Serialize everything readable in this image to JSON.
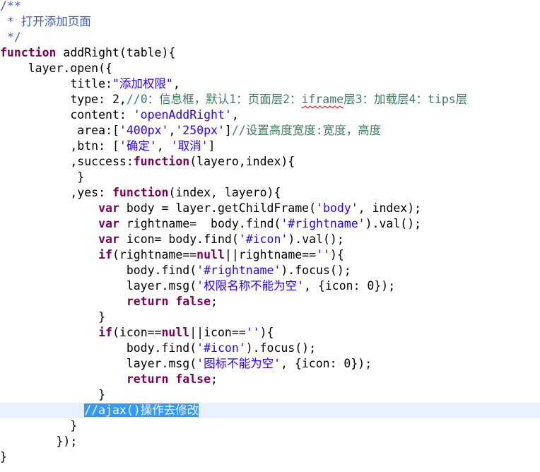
{
  "editor": {
    "colors": {
      "keyword": "#7f0055",
      "string": "#2a00ff",
      "comment": "#3f7f5f",
      "javadoc": "#3f5fbf",
      "plain": "#000000",
      "current_line": "#e8f2fe",
      "selection": "#3399ff"
    },
    "lines": [
      {
        "indent": "",
        "tokens": [
          {
            "t": "/**",
            "k": "javadoc"
          }
        ]
      },
      {
        "indent": " ",
        "tokens": [
          {
            "t": "* 打开添加页面",
            "k": "javadoc"
          }
        ]
      },
      {
        "indent": " ",
        "tokens": [
          {
            "t": "*/",
            "k": "javadoc"
          }
        ]
      },
      {
        "indent": "",
        "tokens": [
          {
            "t": "function",
            "k": "keyword"
          },
          {
            "t": " addRight(table){",
            "k": "plain"
          }
        ]
      },
      {
        "indent": "    ",
        "tokens": [
          {
            "t": "layer.open({",
            "k": "plain"
          }
        ]
      },
      {
        "indent": "          ",
        "tokens": [
          {
            "t": "title:",
            "k": "plain"
          },
          {
            "t": "\"添加权限\"",
            "k": "string"
          },
          {
            "t": ",",
            "k": "plain"
          }
        ]
      },
      {
        "indent": "          ",
        "tokens": [
          {
            "t": "type: 2,",
            "k": "plain"
          },
          {
            "t": "//0：信息框，默认1：页面层2：",
            "k": "comment"
          },
          {
            "t": "iframe",
            "k": "comment",
            "squiggle": true
          },
          {
            "t": "层3：加载层4：tips层",
            "k": "comment"
          }
        ]
      },
      {
        "indent": "          ",
        "tokens": [
          {
            "t": "content: ",
            "k": "plain"
          },
          {
            "t": "'openAddRight'",
            "k": "string"
          },
          {
            "t": ",",
            "k": "plain"
          }
        ]
      },
      {
        "indent": "           ",
        "tokens": [
          {
            "t": "area:[",
            "k": "plain"
          },
          {
            "t": "'400px'",
            "k": "string"
          },
          {
            "t": ",",
            "k": "plain"
          },
          {
            "t": "'250px'",
            "k": "string"
          },
          {
            "t": "]",
            "k": "plain"
          },
          {
            "t": "//设置高度宽度:宽度，高度",
            "k": "comment"
          }
        ]
      },
      {
        "indent": "          ",
        "tokens": [
          {
            "t": ",btn: [",
            "k": "plain"
          },
          {
            "t": "'确定'",
            "k": "string"
          },
          {
            "t": ", ",
            "k": "plain"
          },
          {
            "t": "'取消'",
            "k": "string"
          },
          {
            "t": "]",
            "k": "plain"
          }
        ]
      },
      {
        "indent": "          ",
        "tokens": [
          {
            "t": ",success:",
            "k": "plain"
          },
          {
            "t": "function",
            "k": "keyword"
          },
          {
            "t": "(layero,index){",
            "k": "plain"
          }
        ]
      },
      {
        "indent": "           ",
        "tokens": [
          {
            "t": "}",
            "k": "plain"
          }
        ]
      },
      {
        "indent": "          ",
        "tokens": [
          {
            "t": ",yes: ",
            "k": "plain"
          },
          {
            "t": "function",
            "k": "keyword"
          },
          {
            "t": "(index, layero){",
            "k": "plain"
          }
        ]
      },
      {
        "indent": "              ",
        "tokens": [
          {
            "t": "var",
            "k": "keyword"
          },
          {
            "t": " body = layer.getChildFrame(",
            "k": "plain"
          },
          {
            "t": "'body'",
            "k": "string"
          },
          {
            "t": ", index);",
            "k": "plain"
          }
        ]
      },
      {
        "indent": "              ",
        "tokens": [
          {
            "t": "var",
            "k": "keyword"
          },
          {
            "t": " rightname=  body.find(",
            "k": "plain"
          },
          {
            "t": "'#rightname'",
            "k": "string"
          },
          {
            "t": ").val();",
            "k": "plain"
          }
        ]
      },
      {
        "indent": "              ",
        "tokens": [
          {
            "t": "var",
            "k": "keyword"
          },
          {
            "t": " icon= body.find(",
            "k": "plain"
          },
          {
            "t": "'#icon'",
            "k": "string"
          },
          {
            "t": ").val();",
            "k": "plain"
          }
        ]
      },
      {
        "indent": "              ",
        "tokens": [
          {
            "t": "if",
            "k": "keyword"
          },
          {
            "t": "(rightname==",
            "k": "plain"
          },
          {
            "t": "null",
            "k": "keyword"
          },
          {
            "t": "||rightname==",
            "k": "plain"
          },
          {
            "t": "''",
            "k": "string"
          },
          {
            "t": "){",
            "k": "plain"
          }
        ]
      },
      {
        "indent": "                  ",
        "tokens": [
          {
            "t": "body.find(",
            "k": "plain"
          },
          {
            "t": "'#rightname'",
            "k": "string"
          },
          {
            "t": ").focus();",
            "k": "plain"
          }
        ]
      },
      {
        "indent": "                  ",
        "tokens": [
          {
            "t": "layer.msg(",
            "k": "plain"
          },
          {
            "t": "'权限名称不能为空'",
            "k": "string"
          },
          {
            "t": ", {icon: 0});",
            "k": "plain"
          }
        ]
      },
      {
        "indent": "                  ",
        "tokens": [
          {
            "t": "return",
            "k": "keyword"
          },
          {
            "t": " ",
            "k": "plain"
          },
          {
            "t": "false",
            "k": "keyword"
          },
          {
            "t": ";",
            "k": "plain"
          }
        ]
      },
      {
        "indent": "              ",
        "tokens": [
          {
            "t": "}",
            "k": "plain"
          }
        ]
      },
      {
        "indent": "              ",
        "tokens": [
          {
            "t": "if",
            "k": "keyword"
          },
          {
            "t": "(icon==",
            "k": "plain"
          },
          {
            "t": "null",
            "k": "keyword"
          },
          {
            "t": "||icon==",
            "k": "plain"
          },
          {
            "t": "''",
            "k": "string"
          },
          {
            "t": "){",
            "k": "plain"
          }
        ]
      },
      {
        "indent": "                  ",
        "tokens": [
          {
            "t": "body.find(",
            "k": "plain"
          },
          {
            "t": "'#icon'",
            "k": "string"
          },
          {
            "t": ").focus();",
            "k": "plain"
          }
        ]
      },
      {
        "indent": "                  ",
        "tokens": [
          {
            "t": "layer.msg(",
            "k": "plain"
          },
          {
            "t": "'图标不能为空'",
            "k": "string"
          },
          {
            "t": ", {icon: 0});",
            "k": "plain"
          }
        ]
      },
      {
        "indent": "                  ",
        "tokens": [
          {
            "t": "return",
            "k": "keyword"
          },
          {
            "t": " ",
            "k": "plain"
          },
          {
            "t": "false",
            "k": "keyword"
          },
          {
            "t": ";",
            "k": "plain"
          }
        ]
      },
      {
        "indent": "              ",
        "tokens": [
          {
            "t": "}",
            "k": "plain"
          }
        ]
      },
      {
        "indent": "            ",
        "current": true,
        "tokens": [
          {
            "t": "//ajax()操作去修改",
            "k": "comment",
            "selected": true
          }
        ]
      },
      {
        "indent": "          ",
        "tokens": [
          {
            "t": "}",
            "k": "plain"
          }
        ]
      },
      {
        "indent": "        ",
        "tokens": [
          {
            "t": "});",
            "k": "plain"
          }
        ]
      },
      {
        "indent": "",
        "tokens": [
          {
            "t": "}",
            "k": "plain"
          }
        ]
      }
    ]
  }
}
